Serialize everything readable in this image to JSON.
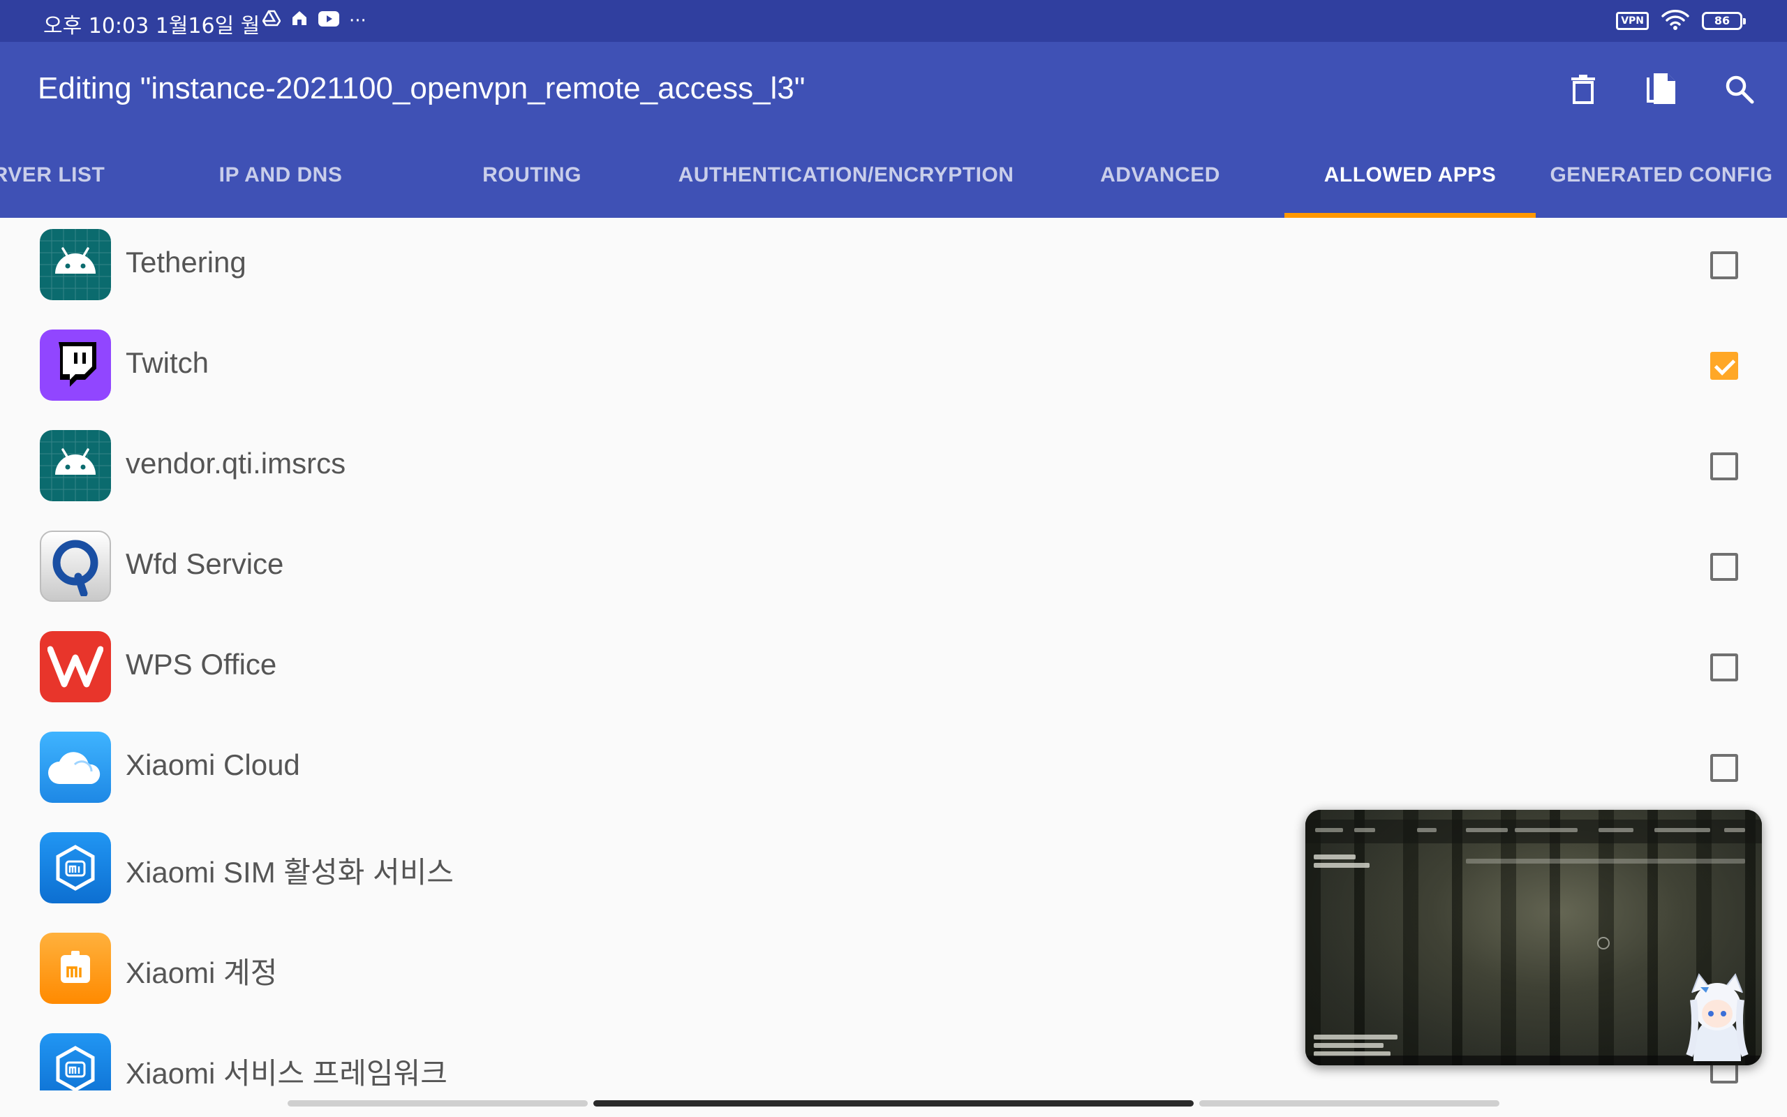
{
  "status_bar": {
    "time": "오후 10:03  1월16일 월",
    "icons": [
      "drive-icon",
      "home-icon",
      "youtube-icon",
      "more-dots-icon"
    ],
    "more": "···",
    "vpn": "VPN",
    "battery": "86"
  },
  "toolbar": {
    "title": "Editing \"instance-2021100_openvpn_remote_access_l3\"",
    "actions": [
      "delete-icon",
      "copy-icon",
      "search-icon"
    ]
  },
  "tabs": [
    {
      "label": "RVER LIST",
      "active": false
    },
    {
      "label": "IP AND DNS",
      "active": false
    },
    {
      "label": "ROUTING",
      "active": false
    },
    {
      "label": "AUTHENTICATION/ENCRYPTION",
      "active": false
    },
    {
      "label": "ADVANCED",
      "active": false
    },
    {
      "label": "ALLOWED APPS",
      "active": true
    },
    {
      "label": "GENERATED CONFIG",
      "active": false
    }
  ],
  "apps": [
    {
      "name": "Tethering",
      "icon": "android-icon",
      "checked": false
    },
    {
      "name": "Twitch",
      "icon": "twitch-icon",
      "checked": true
    },
    {
      "name": "vendor.qti.imsrcs",
      "icon": "android-icon",
      "checked": false
    },
    {
      "name": "Wfd Service",
      "icon": "qualcomm-icon",
      "checked": false
    },
    {
      "name": "WPS Office",
      "icon": "wps-icon",
      "checked": false
    },
    {
      "name": "Xiaomi Cloud",
      "icon": "cloud-icon",
      "checked": false
    },
    {
      "name": "Xiaomi SIM 활성화 서비스",
      "icon": "mi-hexagon-icon",
      "checked": false
    },
    {
      "name": "Xiaomi 계정",
      "icon": "mi-account-icon",
      "checked": false
    },
    {
      "name": "Xiaomi 서비스 프레임워크",
      "icon": "mi-hexagon-icon",
      "checked": false
    }
  ],
  "colors": {
    "status_bar": "#303f9f",
    "toolbar": "#3f51b5",
    "tab_indicator": "#ff9800",
    "checkbox_checked": "#ffa726"
  }
}
